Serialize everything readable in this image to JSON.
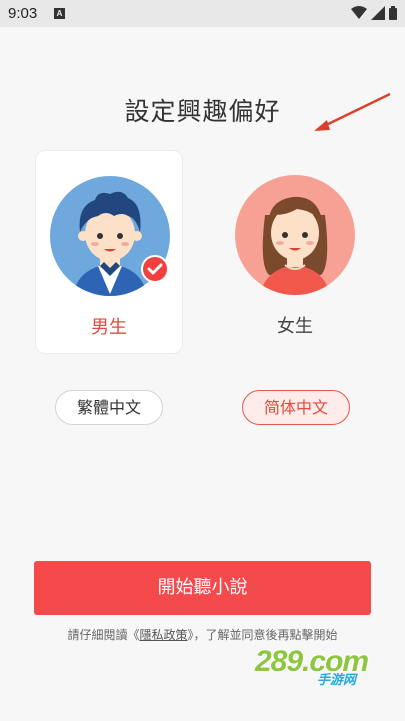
{
  "status_bar": {
    "time": "9:03",
    "notif_glyph": "A"
  },
  "title": "設定興趣偏好",
  "genders": [
    {
      "label": "男生",
      "selected": true
    },
    {
      "label": "女生",
      "selected": false
    }
  ],
  "languages": [
    {
      "label": "繁體中文",
      "selected": false
    },
    {
      "label": "简体中文",
      "selected": true
    }
  ],
  "start_button": "開始聽小說",
  "policy": {
    "prefix": "請仔細閱讀《",
    "link": "隱私政策",
    "suffix": "》，了解並同意後再點擊開始"
  },
  "watermark": {
    "logo": "289.com",
    "sub": "手游网"
  },
  "colors": {
    "accent": "#f54a4c",
    "male_bg": "#6fa8dc",
    "female_bg": "#f7a195"
  }
}
